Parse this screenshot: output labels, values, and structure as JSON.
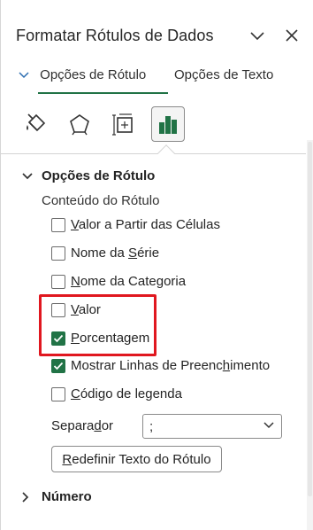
{
  "pane": {
    "title": "Formatar Rótulos de Dados"
  },
  "tabs": [
    {
      "label": "Opções de Rótulo",
      "active": true
    },
    {
      "label": "Opções de Texto",
      "active": false
    }
  ],
  "icon_tabs": [
    {
      "icon": "fill-line-icon"
    },
    {
      "icon": "effects-pentagon-icon"
    },
    {
      "icon": "size-properties-icon"
    },
    {
      "icon": "label-options-bar-chart-icon",
      "selected": true
    }
  ],
  "label_options": {
    "header": "Opções de Rótulo",
    "content_heading": "Conteúdo do Rótulo",
    "checkboxes": [
      {
        "pre": "",
        "u": "V",
        "post": "alor a Partir das Células",
        "checked": false
      },
      {
        "pre": "Nome da ",
        "u": "S",
        "post": "érie",
        "checked": false
      },
      {
        "pre": "",
        "u": "N",
        "post": "ome da Categoria",
        "checked": false
      },
      {
        "pre": "",
        "u": "V",
        "post": "alor",
        "checked": false
      },
      {
        "pre": "",
        "u": "P",
        "post": "orcentagem",
        "checked": true
      },
      {
        "pre": "Mostrar Linhas de Preenc",
        "u": "h",
        "post": "imento",
        "checked": true
      },
      {
        "pre": "",
        "u": "C",
        "post": "ódigo de legenda",
        "checked": false
      }
    ],
    "separator": {
      "pre": "Separa",
      "u": "d",
      "post": "or",
      "value": ";"
    },
    "reset_button": {
      "pre": "",
      "u": "R",
      "post": "edefinir Texto do Rótulo"
    }
  },
  "number_section": {
    "header": "Número"
  },
  "colors": {
    "accent_green": "#217346",
    "highlight_red": "#e0171f"
  }
}
